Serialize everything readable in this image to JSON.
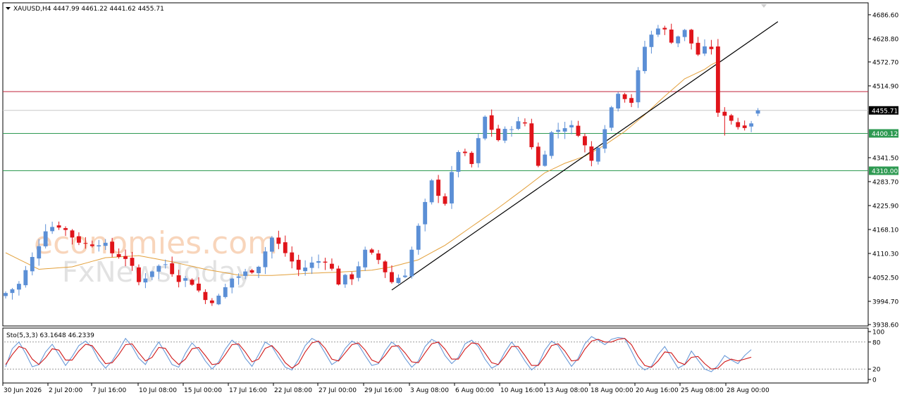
{
  "header": {
    "symbol_info": "XAUUSD,H4  4447.99 4461.22 4441.62 4455.71",
    "stoch_info": "Sto(5,3,3) 63.1648 46.2339"
  },
  "watermark": {
    "line1": "economies.com",
    "line2": "FxNewsToday"
  },
  "colors": {
    "bull": "#5b8fd6",
    "bear": "#e0141a",
    "ma": "#e3a03b",
    "resistance": "#c0243a",
    "support": "#2e9a52",
    "current": "#c8c8c8",
    "stoch_main": "#6a9ad8",
    "stoch_signal": "#d01818"
  },
  "chart_data": [
    {
      "type": "candlestick",
      "title": "XAUUSD,H4",
      "ohlc_last": {
        "open": 4447.99,
        "high": 4461.22,
        "low": 4441.62,
        "close": 4455.71
      },
      "ylim": [
        3938.6,
        4712.0
      ],
      "y_ticks": [
        "4686.60",
        "4628.80",
        "4572.70",
        "4514.90",
        "4455.71",
        "4400.12",
        "4341.50",
        "4310.00",
        "4283.70",
        "4225.90",
        "4168.10",
        "4110.30",
        "4052.50",
        "3994.70",
        "3938.60"
      ],
      "x_ticks": [
        "30 Jun 2026",
        "2 Jul 20:00",
        "7 Jul 16:00",
        "10 Jul 08:00",
        "15 Jul 00:00",
        "17 Jul 16:00",
        "22 Jul 08:00",
        "27 Jul 00:00",
        "29 Jul 16:00",
        "3 Aug 08:00",
        "6 Aug 00:00",
        "10 Aug 16:00",
        "13 Aug 08:00",
        "18 Aug 00:00",
        "20 Aug 16:00",
        "25 Aug 08:00",
        "28 Aug 00:00"
      ],
      "levels": [
        {
          "value": 4501.0,
          "label": "4501.00",
          "role": "resistance"
        },
        {
          "value": 4400.12,
          "label": "4400.12",
          "role": "support"
        },
        {
          "value": 4310.0,
          "label": "4310.00",
          "role": "support"
        },
        {
          "value": 4455.71,
          "label": "4455.71",
          "role": "current"
        }
      ],
      "trendline": {
        "from": {
          "bar": 58,
          "price": 4022
        },
        "to": {
          "bar": 116,
          "price": 4670
        }
      },
      "ma_waypoints": [
        [
          0,
          4112
        ],
        [
          5,
          4072
        ],
        [
          10,
          4078
        ],
        [
          15,
          4100
        ],
        [
          20,
          4105
        ],
        [
          25,
          4090
        ],
        [
          30,
          4072
        ],
        [
          35,
          4058
        ],
        [
          40,
          4057
        ],
        [
          45,
          4062
        ],
        [
          50,
          4065
        ],
        [
          55,
          4070
        ],
        [
          58,
          4078
        ],
        [
          62,
          4095
        ],
        [
          66,
          4130
        ],
        [
          70,
          4175
        ],
        [
          74,
          4220
        ],
        [
          78,
          4268
        ],
        [
          81,
          4305
        ],
        [
          84,
          4328
        ],
        [
          87,
          4345
        ],
        [
          90,
          4372
        ],
        [
          93,
          4405
        ],
        [
          96,
          4445
        ],
        [
          99,
          4490
        ],
        [
          102,
          4532
        ],
        [
          105,
          4555
        ],
        [
          106,
          4566
        ],
        [
          107,
          4574
        ]
      ],
      "close_waypoints": [
        [
          0,
          4015
        ],
        [
          2,
          4035
        ],
        [
          4,
          4098
        ],
        [
          6,
          4172
        ],
        [
          8,
          4180
        ],
        [
          10,
          4152
        ],
        [
          12,
          4132
        ],
        [
          14,
          4140
        ],
        [
          16,
          4112
        ],
        [
          18,
          4102
        ],
        [
          20,
          4040
        ],
        [
          22,
          4072
        ],
        [
          24,
          4085
        ],
        [
          26,
          4052
        ],
        [
          28,
          4042
        ],
        [
          30,
          3998
        ],
        [
          32,
          4002
        ],
        [
          34,
          4050
        ],
        [
          36,
          4062
        ],
        [
          38,
          4085
        ],
        [
          40,
          4148
        ],
        [
          42,
          4112
        ],
        [
          44,
          4070
        ],
        [
          46,
          4085
        ],
        [
          48,
          4098
        ],
        [
          50,
          4042
        ],
        [
          52,
          4055
        ],
        [
          54,
          4112
        ],
        [
          56,
          4095
        ],
        [
          58,
          4042
        ],
        [
          60,
          4065
        ],
        [
          62,
          4172
        ],
        [
          64,
          4280
        ],
        [
          66,
          4235
        ],
        [
          68,
          4360
        ],
        [
          70,
          4325
        ],
        [
          72,
          4438
        ],
        [
          74,
          4385
        ],
        [
          76,
          4420
        ],
        [
          78,
          4425
        ],
        [
          80,
          4320
        ],
        [
          82,
          4400
        ],
        [
          84,
          4420
        ],
        [
          86,
          4405
        ],
        [
          88,
          4332
        ],
        [
          90,
          4420
        ],
        [
          92,
          4505
        ],
        [
          94,
          4478
        ],
        [
          96,
          4610
        ],
        [
          98,
          4662
        ],
        [
          100,
          4628
        ],
        [
          102,
          4645
        ],
        [
          104,
          4592
        ],
        [
          106,
          4608
        ],
        [
          107,
          4515
        ],
        [
          108,
          4450
        ],
        [
          110,
          4418
        ],
        [
          112,
          4430
        ],
        [
          113,
          4455.71
        ]
      ]
    },
    {
      "type": "line",
      "title": "Sto(5,3,3)",
      "ylim": [
        0,
        100
      ],
      "y_ticks": [
        "100",
        "80",
        "20",
        "0"
      ],
      "levels": [
        80,
        20
      ],
      "series": [
        {
          "name": "main",
          "last": 63.1648,
          "values": [
            25,
            65,
            80,
            55,
            25,
            30,
            58,
            75,
            52,
            28,
            48,
            72,
            82,
            68,
            40,
            22,
            38,
            62,
            88,
            70,
            44,
            30,
            58,
            80,
            56,
            30,
            24,
            55,
            78,
            62,
            38,
            20,
            36,
            64,
            84,
            72,
            44,
            26,
            52,
            80,
            70,
            46,
            24,
            18,
            42,
            72,
            88,
            80,
            55,
            30,
            40,
            66,
            82,
            74,
            50,
            28,
            32,
            60,
            80,
            68,
            44,
            24,
            38,
            70,
            86,
            78,
            50,
            32,
            46,
            76,
            84,
            70,
            42,
            22,
            30,
            58,
            80,
            62,
            38,
            18,
            30,
            62,
            82,
            72,
            48,
            26,
            44,
            76,
            92,
            84,
            74,
            86,
            90,
            88,
            60,
            30,
            18,
            26,
            52,
            70,
            46,
            22,
            30,
            60,
            40,
            20,
            14,
            28,
            50,
            40,
            32,
            50,
            63.1648
          ]
        },
        {
          "name": "signal",
          "last": 46.2339,
          "values": [
            30,
            52,
            70,
            65,
            42,
            30,
            45,
            65,
            62,
            40,
            40,
            60,
            75,
            72,
            52,
            32,
            34,
            52,
            74,
            76,
            56,
            38,
            46,
            68,
            66,
            44,
            30,
            42,
            65,
            68,
            50,
            30,
            32,
            52,
            74,
            76,
            58,
            36,
            42,
            66,
            72,
            56,
            34,
            22,
            32,
            58,
            78,
            82,
            66,
            42,
            38,
            56,
            74,
            78,
            62,
            40,
            34,
            50,
            70,
            72,
            56,
            36,
            34,
            56,
            76,
            80,
            64,
            42,
            42,
            64,
            78,
            76,
            56,
            34,
            30,
            48,
            70,
            70,
            50,
            28,
            28,
            48,
            72,
            76,
            60,
            38,
            40,
            64,
            82,
            86,
            80,
            80,
            86,
            88,
            74,
            48,
            28,
            24,
            38,
            58,
            56,
            36,
            30,
            46,
            48,
            32,
            20,
            22,
            36,
            42,
            38,
            42,
            46.2339
          ]
        }
      ]
    }
  ]
}
